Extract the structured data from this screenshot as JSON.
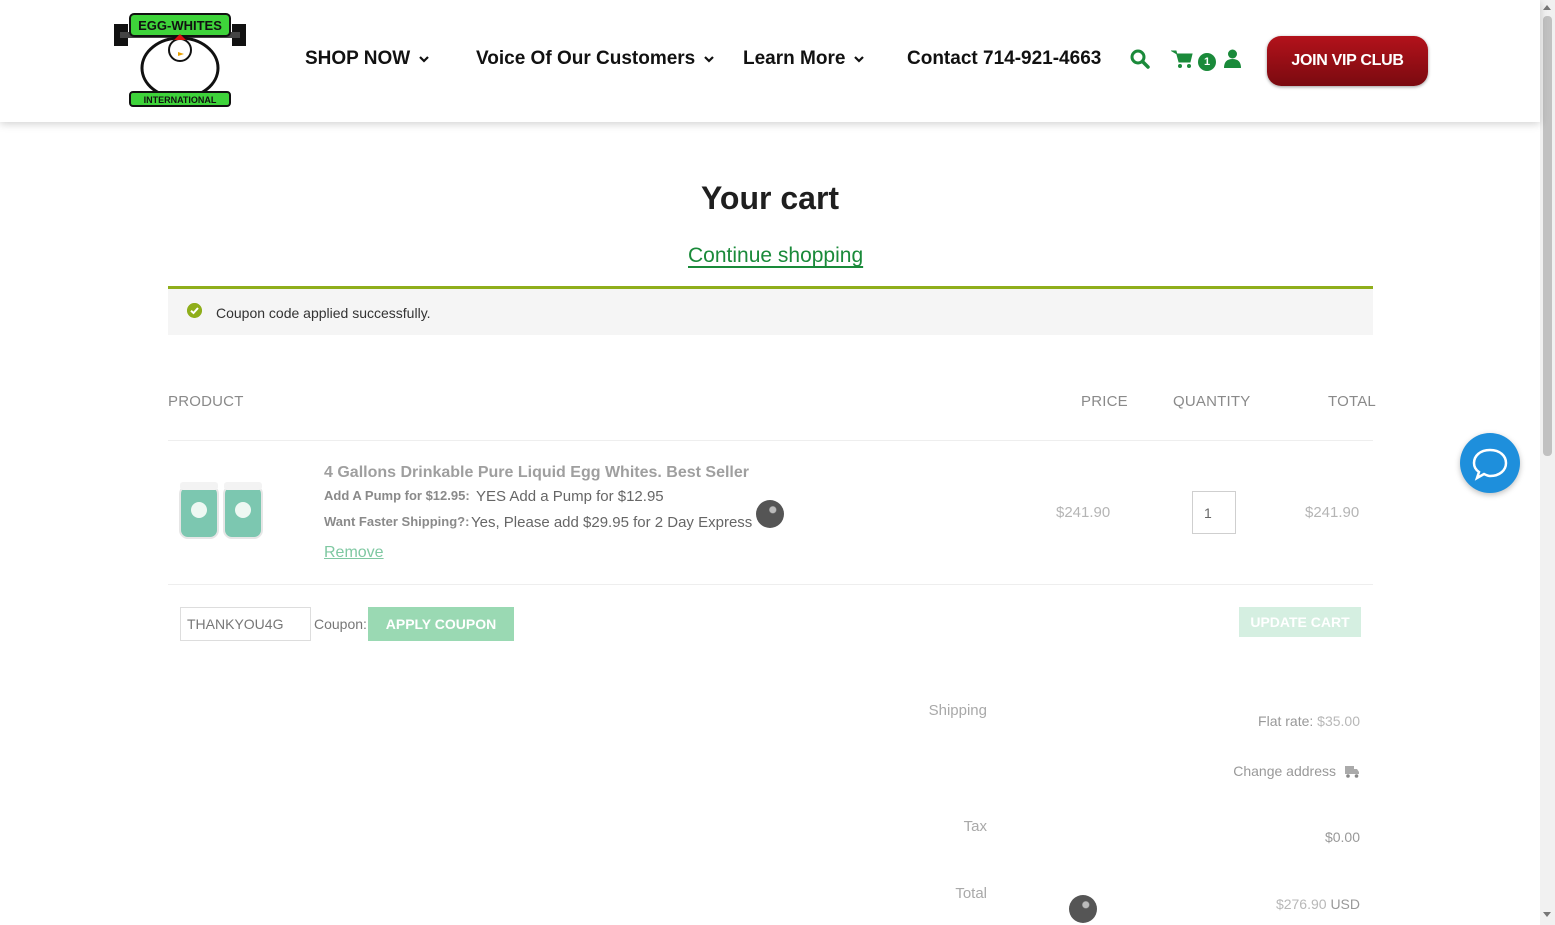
{
  "header": {
    "logo_alt": "Egg Whites International",
    "nav": [
      {
        "label": "SHOP NOW"
      },
      {
        "label": "Voice Of Our Customers"
      },
      {
        "label": "Learn More"
      }
    ],
    "contact": "Contact 714-921-4663",
    "cart_count": "1",
    "join_vip": "JOIN VIP CLUB"
  },
  "colors": {
    "brand_green": "#1a8a3a",
    "vip_red": "#9a0e16",
    "notice_bar": "#8fae1b",
    "chat_blue": "#1e8fdc"
  },
  "cart": {
    "title": "Your cart",
    "continue_shopping": "Continue shopping",
    "notice": "Coupon code applied successfully.",
    "columns": {
      "product": "PRODUCT",
      "price": "PRICE",
      "quantity": "QUANTITY",
      "total": "TOTAL"
    },
    "item": {
      "name": "4 Gallons Drinkable Pure Liquid Egg Whites. Best Seller",
      "options": [
        {
          "label": "Add A Pump for $12.95:",
          "value": "YES Add a Pump for $12.95"
        },
        {
          "label": "Want Faster Shipping?:",
          "value": "Yes, Please add $29.95 for 2 Day Express"
        }
      ],
      "remove": "Remove",
      "price": "$241.90",
      "quantity": "1",
      "total": "$241.90"
    },
    "coupon_value": "THANKYOU4G",
    "coupon_label": "Coupon:",
    "apply_coupon": "APPLY COUPON",
    "update_cart": "UPDATE CART"
  },
  "totals": {
    "shipping_label": "Shipping",
    "shipping_method": "Flat rate:",
    "shipping_amount": "$35.00",
    "change_address": "Change address",
    "tax_label": "Tax",
    "tax_amount": "$0.00",
    "total_label": "Total",
    "total_amount": "$276.90",
    "currency": "USD"
  }
}
